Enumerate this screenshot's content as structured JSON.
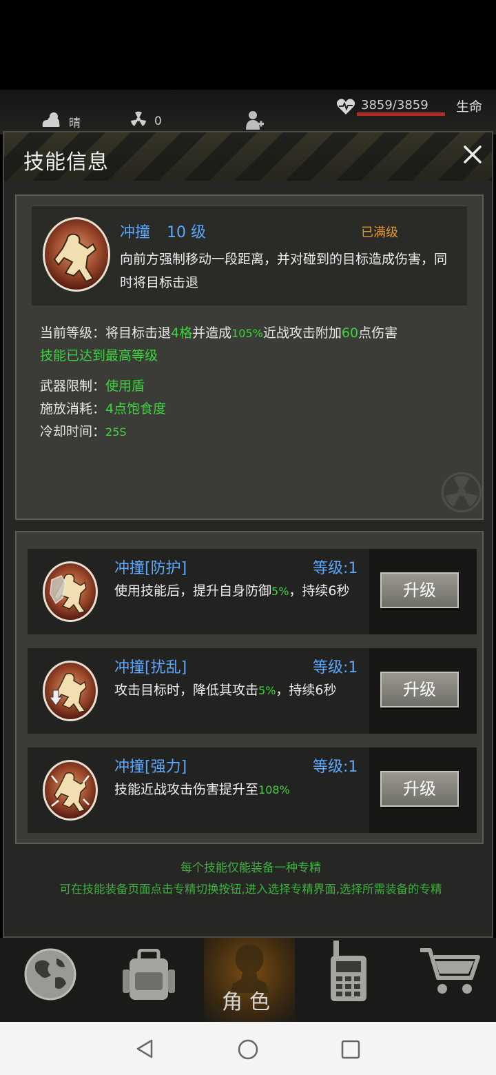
{
  "status_bar": {
    "weather_label": "晴",
    "radiation_value": "0",
    "hp_value": "3859/3859",
    "hp_label": "生命",
    "hp_fraction": 1.0
  },
  "modal": {
    "title": "技能信息",
    "skill": {
      "name": "冲撞",
      "level": "10 级",
      "status": "已满级",
      "description": "向前方强制移动一段距离，并对碰到的目标造成伤害，同时将目标击退",
      "current_prefix": "当前等级：将目标击退",
      "current_knockback": "4格",
      "current_mid": "并造成",
      "current_percent": "105%",
      "current_mid2": "近战攻击附加",
      "current_bonus": "60",
      "current_suffix": "点伤害",
      "max_note": "技能已达到最高等级",
      "weapon_label": "武器限制：",
      "weapon_value": "使用盾",
      "cost_label": "施放消耗：",
      "cost_value": "4点饱食度",
      "cooldown_label": "冷却时间：",
      "cooldown_value": "25S"
    },
    "specializations": [
      {
        "name": "冲撞[防护]",
        "level": "等级:1",
        "desc_prefix": "使用技能后，提升自身防御",
        "desc_value": "5%",
        "desc_suffix": "，持续6秒",
        "button": "升级",
        "icon": "shield-charge-icon"
      },
      {
        "name": "冲撞[扰乱]",
        "level": "等级:1",
        "desc_prefix": "攻击目标时，降低其攻击",
        "desc_value": "5%",
        "desc_suffix": "，持续6秒",
        "button": "升级",
        "icon": "disrupt-charge-icon"
      },
      {
        "name": "冲撞[强力]",
        "level": "等级:1",
        "desc_prefix": "技能近战攻击伤害提升至",
        "desc_value": "108%",
        "desc_suffix": "",
        "button": "升级",
        "icon": "power-charge-icon"
      }
    ],
    "note_line1": "每个技能仅能装备一种专精",
    "note_line2": "可在技能装备页面点击专精切换按钮,进入选择专精界面,选择所需装备的专精"
  },
  "bottom_nav": {
    "active_label": "角色",
    "items": [
      "globe-icon",
      "backpack-icon",
      "character-icon",
      "radio-icon",
      "cart-icon"
    ]
  },
  "colors": {
    "accent_blue": "#5aa8ff",
    "highlight_green": "#3fd43f",
    "maxed_orange": "#e39a2c"
  }
}
